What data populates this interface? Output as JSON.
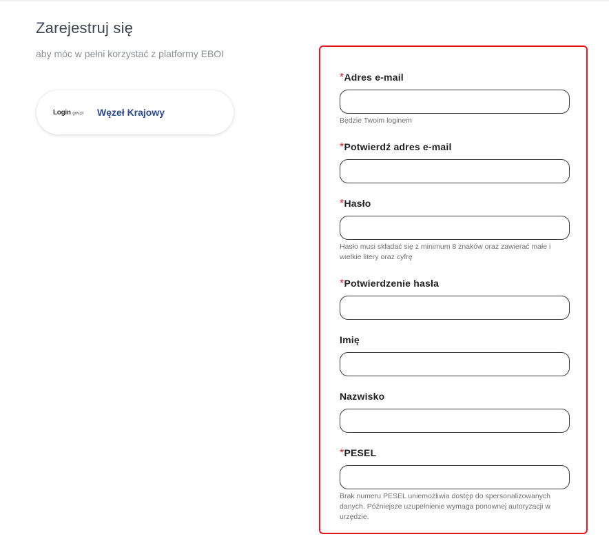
{
  "header": {
    "title": "Zarejestruj się",
    "subtitle": "aby móc w pełni korzystać z platformy EBOI"
  },
  "login_card": {
    "logo_main": "Login",
    "logo_sub": ".gov.pl",
    "label": "Węzeł Krajowy"
  },
  "form": {
    "required_mark": "*",
    "fields": [
      {
        "label": "Adres e-mail",
        "required": true,
        "value": "",
        "hint": "Będzie Twoim loginem"
      },
      {
        "label": "Potwierdź adres e-mail",
        "required": true,
        "value": "",
        "hint": ""
      },
      {
        "label": "Hasło",
        "required": true,
        "value": "",
        "hint": "Hasło musi składać się z minimum 8 znaków oraz zawierać małe i wielkie litery oraz cyfrę"
      },
      {
        "label": "Potwierdzenie hasła",
        "required": true,
        "value": "",
        "hint": ""
      },
      {
        "label": "Imię",
        "required": false,
        "value": "",
        "hint": ""
      },
      {
        "label": "Nazwisko",
        "required": false,
        "value": "",
        "hint": ""
      },
      {
        "label": "PESEL",
        "required": true,
        "value": "",
        "hint": "Brak numeru PESEL uniemożliwia dostęp do spersonalizowanych danych. Późniejsze uzupełnienie wymaga ponownej autoryzacji w urzędzie."
      }
    ]
  },
  "colors": {
    "highlight_border": "#e8141e",
    "required_mark": "#d4202a",
    "card_label": "#2d4a8a"
  }
}
